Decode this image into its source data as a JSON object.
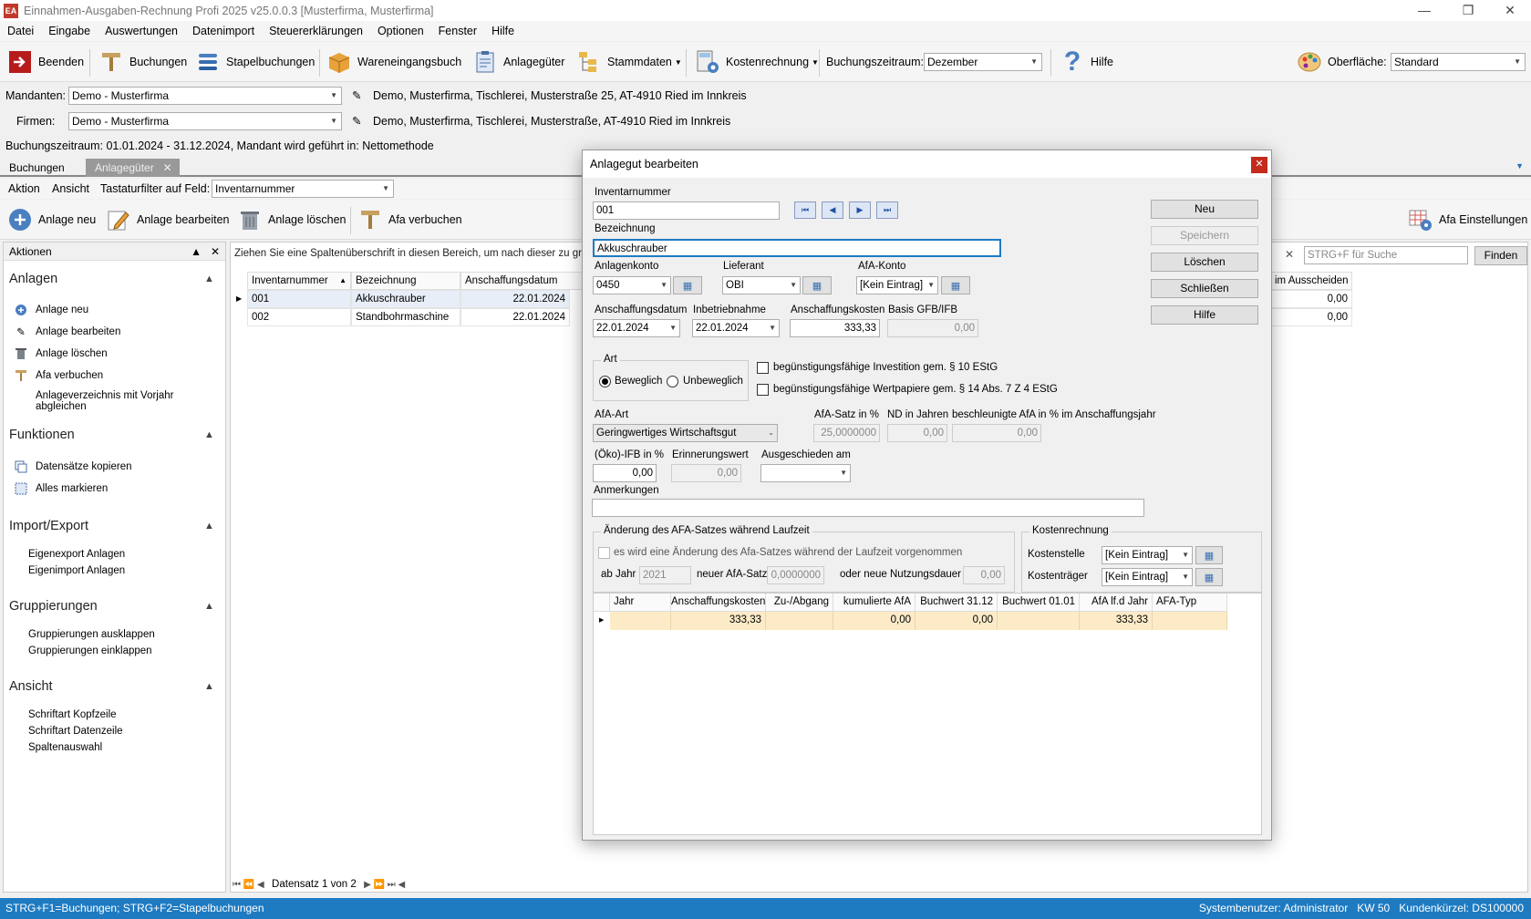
{
  "window": {
    "title": "Einnahmen-Ausgaben-Rechnung Profi 2025 v25.0.0.3 [Musterfirma, Musterfirma]",
    "app_icon": "EA"
  },
  "menu": [
    "Datei",
    "Eingabe",
    "Auswertungen",
    "Datenimport",
    "Steuererklärungen",
    "Optionen",
    "Fenster",
    "Hilfe"
  ],
  "toolbar": {
    "beenden": "Beenden",
    "buchungen": "Buchungen",
    "stapelbuchungen": "Stapelbuchungen",
    "wareneingangsbuch": "Wareneingangsbuch",
    "anlagegueter": "Anlagegüter",
    "stammdaten": "Stammdaten",
    "kostenrechnung": "Kostenrechnung",
    "buchungszeitraum_label": "Buchungszeitraum:",
    "buchungszeitraum_value": "Dezember",
    "hilfe": "Hilfe",
    "oberflaeche_label": "Oberfläche:",
    "oberflaeche_value": "Standard"
  },
  "context": {
    "mandanten_label": "Mandanten:",
    "mandanten_value": "Demo - Musterfirma",
    "mandanten_info": "Demo, Musterfirma, Tischlerei, Musterstraße 25, AT-4910 Ried im Innkreis",
    "firmen_label": "Firmen:",
    "firmen_value": "Demo - Musterfirma",
    "firmen_info": "Demo, Musterfirma, Tischlerei, Musterstraße, AT-4910 Ried im Innkreis",
    "period_info": "Buchungszeitraum: 01.01.2024 - 31.12.2024, Mandant wird geführt in:  Nettomethode"
  },
  "tabs": {
    "buchungen": "Buchungen",
    "anlagegueter": "Anlagegüter"
  },
  "actionbar": {
    "aktion": "Aktion",
    "ansicht": "Ansicht",
    "filter_label": "Tastaturfilter auf Feld:",
    "filter_value": "Inventarnummer"
  },
  "ribbon": {
    "anlage_neu": "Anlage neu",
    "anlage_bearbeiten": "Anlage bearbeiten",
    "anlage_loeschen": "Anlage löschen",
    "afa_verbuchen": "Afa verbuchen",
    "afa_einstellungen": "Afa Einstellungen"
  },
  "leftpanel": {
    "header": "Aktionen",
    "sections": {
      "anlagen": "Anlagen",
      "funktionen": "Funktionen",
      "import_export": "Import/Export",
      "gruppierungen": "Gruppierungen",
      "ansicht": "Ansicht"
    },
    "anlagen_items": [
      "Anlage neu",
      "Anlage bearbeiten",
      "Anlage löschen",
      "Afa verbuchen",
      "Anlageverzeichnis mit Vorjahr abgleichen"
    ],
    "funktionen_items": [
      "Datensätze kopieren",
      "Alles markieren"
    ],
    "import_items": [
      "Eigenexport Anlagen",
      "Eigenimport Anlagen"
    ],
    "gruppierungen_items": [
      "Gruppierungen ausklappen",
      "Gruppierungen einklappen"
    ],
    "ansicht_items": [
      "Schriftart Kopfzeile",
      "Schriftart Datenzeile",
      "Spaltenauswahl"
    ]
  },
  "grid": {
    "hint": "Ziehen Sie eine Spaltenüberschrift in diesen Bereich, um nach dieser zu gruppieren",
    "search_placeholder": "STRG+F für Suche",
    "find_button": "Finden",
    "columns": [
      "Inventarnummer",
      "Bezeichnung",
      "Anschaffungsdatum",
      "im Ausscheiden"
    ],
    "rows": [
      {
        "nr": "001",
        "bez": "Akkuschrauber",
        "datum": "22.01.2024",
        "aus": "0,00"
      },
      {
        "nr": "002",
        "bez": "Standbohrmaschine",
        "datum": "22.01.2024",
        "aus": "0,00"
      }
    ],
    "nav": "Datensatz 1 von 2"
  },
  "dialog": {
    "title": "Anlagegut bearbeiten",
    "inventarnummer_label": "Inventarnummer",
    "inventarnummer": "001",
    "bezeichnung_label": "Bezeichnung",
    "bezeichnung": "Akkuschrauber",
    "anlagenkonto_label": "Anlagenkonto",
    "anlagenkonto": "0450",
    "lieferant_label": "Lieferant",
    "lieferant": "OBI",
    "afa_konto_label": "AfA-Konto",
    "afa_konto": "[Kein Eintrag]",
    "anschaffungsdatum_label": "Anschaffungsdatum",
    "anschaffungsdatum": "22.01.2024",
    "inbetriebnahme_label": "Inbetriebnahme",
    "inbetriebnahme": "22.01.2024",
    "anschaffungskosten_label": "Anschaffungskosten",
    "anschaffungskosten": "333,33",
    "basis_label": "Basis GFB/IFB",
    "basis": "0,00",
    "art_label": "Art",
    "beweglich": "Beweglich",
    "unbeweglich": "Unbeweglich",
    "chk_invest": "begünstigungsfähige Investition gem. § 10 EStG",
    "chk_wertpapiere": "begünstigungsfähige Wertpapiere gem. § 14 Abs. 7 Z 4 EStG",
    "afa_art_label": "AfA-Art",
    "afa_art": "Geringwertiges Wirtschaftsgut",
    "afa_satz_label": "AfA-Satz in %",
    "afa_satz": "25,0000000",
    "nd_label": "ND in Jahren",
    "nd": "0,00",
    "beschl_label": "beschleunigte AfA in % im Anschaffungsjahr",
    "beschl": "0,00",
    "ifb_label": "(Öko)-IFB in %",
    "ifb": "0,00",
    "erinnerung_label": "Erinnerungswert",
    "erinnerung": "0,00",
    "ausgeschieden_label": "Ausgeschieden am",
    "ausgeschieden": "",
    "anmerkungen_label": "Anmerkungen",
    "anmerkungen": "",
    "aenderung_group": "Änderung des AFA-Satzes während Laufzeit",
    "aenderung_chk": "es wird eine Änderung des Afa-Satzes während der Laufzeit vorgenommen",
    "ab_jahr_label": "ab Jahr",
    "ab_jahr": "2021",
    "neuer_satz_label": "neuer AfA-Satz",
    "neuer_satz": "0,0000000",
    "nutzungsdauer_label": "oder neue Nutzungsdauer",
    "nutzungsdauer": "0,00",
    "kosten_group": "Kostenrechnung",
    "kostenstelle_label": "Kostenstelle",
    "kostenstelle": "[Kein Eintrag]",
    "kostentraeger_label": "Kostenträger",
    "kostentraeger": "[Kein Eintrag]",
    "buttons": {
      "neu": "Neu",
      "speichern": "Speichern",
      "loeschen": "Löschen",
      "schliessen": "Schließen",
      "hilfe": "Hilfe"
    },
    "afa_columns": [
      "Jahr",
      "Anschaffungskosten",
      "Zu-/Abgang",
      "kumulierte AfA",
      "Buchwert 31.12",
      "Buchwert 01.01",
      "AfA lf.d Jahr",
      "AFA-Typ"
    ],
    "afa_row": [
      "",
      "333,33",
      "",
      "0,00",
      "0,00",
      "",
      "333,33",
      ""
    ]
  },
  "statusbar": {
    "left": "STRG+F1=Buchungen; STRG+F2=Stapelbuchungen",
    "right": "Systembenutzer: Administrator   KW 50   Kundenkürzel: DS100000"
  }
}
